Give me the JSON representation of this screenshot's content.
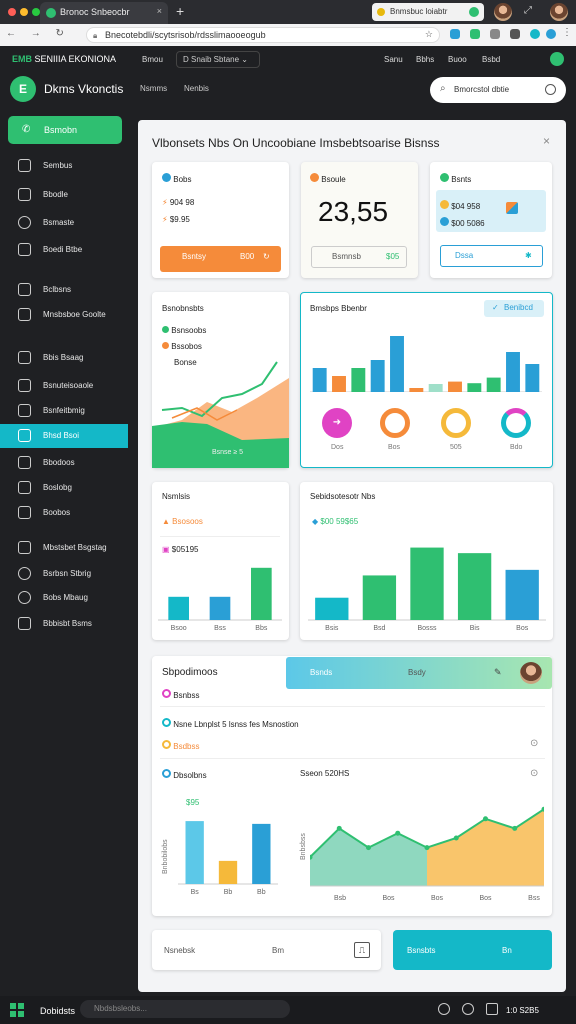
{
  "browser": {
    "tab_title": "Bronoc Snbeocbr",
    "tab_close": "×",
    "new_tab": "+",
    "ext_label": "Bnmsbuc loiabtr",
    "nav_icons": "← → ↻",
    "url": "Bnecotebdli/scytsrisob/rdsslimaooeogub",
    "url_star": "☆"
  },
  "header": {
    "brand_left": "EMB",
    "brand_right": "SENIIIA EKONIONA",
    "dropdown": "D Snaib Sbtane ⌄",
    "links": [
      "Bmou",
      "Sanu",
      "Bbhs",
      "Buoo",
      "Bsbd"
    ],
    "app_logo": "E",
    "app_title": "Dkms Vkonctis",
    "sublinks": [
      "Nsmms",
      "Nenbis"
    ],
    "search_placeholder": "Bmorcstol dbtie"
  },
  "sidebar": {
    "cta_label": "Bsmobn",
    "items": [
      {
        "label": "Sembus"
      },
      {
        "label": "Bbodle"
      },
      {
        "label": "Bsmaste"
      },
      {
        "label": "Boedi Btbe"
      },
      {
        "label": "Bclbsns"
      },
      {
        "label": "Mnsbsboe Goolte"
      },
      {
        "label": "Bbis Bsaag"
      },
      {
        "label": "Bsnuteisoaole"
      },
      {
        "label": "Bsnfeitbmig"
      },
      {
        "label": "Bhsd Bsoi"
      },
      {
        "label": "Bbodoos"
      },
      {
        "label": "Boslobg"
      },
      {
        "label": "Boobos"
      },
      {
        "label": "Mbstsbet Bsgstag"
      },
      {
        "label": "Bsrbsn Stbrig"
      },
      {
        "label": "Bobs Mbaug"
      },
      {
        "label": "Bbbisbt Bsms"
      }
    ]
  },
  "main": {
    "title": "Vlbonsets Nbs On Uncoobiane Imsbebtsoarise Bisnss",
    "close": "×",
    "card1": {
      "label": "Bobs",
      "line1": "904 98",
      "line2": "$9.95",
      "button": "Bsntsy",
      "button_value": "B00"
    },
    "card2": {
      "label": "Bsoule",
      "big_number": "23,55",
      "button": "Bsmnsb",
      "button_value": "$05"
    },
    "card3": {
      "label": "Bsnts",
      "line1": "$04 958",
      "line2": "$00 5086",
      "button": "Dssa"
    },
    "card4": {
      "title": "Bsnobnsbts",
      "legend": [
        "Bsnsoobs",
        "Bssobos",
        "Bonse"
      ],
      "footer": "Bsnse ≥ 5"
    },
    "card5": {
      "title": "Bmsbps Bbenbr",
      "button": "Benibcd",
      "ring_labels": [
        "Dos",
        "Bos",
        "505",
        "Bdo"
      ]
    },
    "card6": {
      "title": "Nsmlsis",
      "row1": "Bsosoos",
      "row2": "$05195",
      "x_labels": [
        "Bsoo",
        "Bss",
        "Bbs"
      ]
    },
    "card7": {
      "title": "Sebidsotesotr Nbs",
      "row1": "$00 59$65",
      "x_labels": [
        "Bsis",
        "Bsd",
        "Bosss",
        "Bis",
        "Bos"
      ]
    },
    "bottom": {
      "title": "Sbpodimoos",
      "banner_left": "Bsnds",
      "banner_right": "Bsdy",
      "row1": "Bsnbss",
      "row2": "Nsne Lbnplst 5 lsnss fes Msnostion",
      "row3": "Bsdbss",
      "row3_icon": "⊙",
      "chart_left_title": "Dbsolbns",
      "chart_left_value": "$95",
      "chart_left_ylabel": "Bnbobilobs",
      "chart_left_x": [
        "Bs",
        "Bb",
        "Bb"
      ],
      "chart_right_title": "Sseon 520HS",
      "chart_right_ylabel": "Bnbsbss",
      "chart_right_x": [
        "Bsb",
        "Bos",
        "Bos",
        "Bos",
        "Bss"
      ]
    },
    "footer_card_left": "Nsnebsk",
    "footer_card_left_mid": "Bm",
    "footer_card_right": "Bsnsbts",
    "footer_card_right_mid": "Bn"
  },
  "taskbar": {
    "label": "Dobidsts",
    "search": "Nbdsbsleobs...",
    "clock": "1:0 S2B5"
  },
  "colors": {
    "accent_green": "#2fbf71",
    "accent_teal": "#14b8c8",
    "orange": "#f58b3a",
    "blue": "#2a9fd6"
  },
  "chart_data": [
    {
      "type": "bar",
      "categories": [
        "1",
        "2",
        "3",
        "4",
        "5",
        "6",
        "7",
        "8",
        "9",
        "10",
        "11",
        "12"
      ],
      "series": [
        {
          "values": [
            3,
            2,
            3,
            4,
            7,
            0.5,
            1,
            1.3,
            1.1,
            1.8,
            5,
            3.5
          ]
        }
      ],
      "ylim": [
        0,
        8
      ]
    },
    {
      "type": "bar",
      "categories": [
        "Bsoo",
        "Bss",
        "Bbs"
      ],
      "series": [
        {
          "values": [
            2,
            2,
            4.5
          ]
        }
      ],
      "ylim": [
        0,
        5
      ]
    },
    {
      "type": "bar",
      "categories": [
        "Bsis",
        "Bsd",
        "Bosss",
        "Bis",
        "Bos"
      ],
      "series": [
        {
          "values": [
            2,
            4,
            6.5,
            6,
            4.5
          ]
        }
      ],
      "ylim": [
        0,
        7
      ]
    },
    {
      "type": "bar",
      "categories": [
        "Bs",
        "Bb",
        "Bb"
      ],
      "series": [
        {
          "values": [
            6.8,
            2.5,
            6.5
          ]
        }
      ],
      "ylim": [
        0,
        8
      ]
    },
    {
      "type": "line",
      "x": [
        "Bsb",
        "Bos",
        "Bos",
        "Bos",
        "Bss"
      ],
      "series": [
        {
          "values": [
            3,
            6,
            4,
            5.5,
            4,
            5,
            7,
            6,
            8
          ]
        }
      ],
      "ylim": [
        0,
        10
      ]
    }
  ]
}
